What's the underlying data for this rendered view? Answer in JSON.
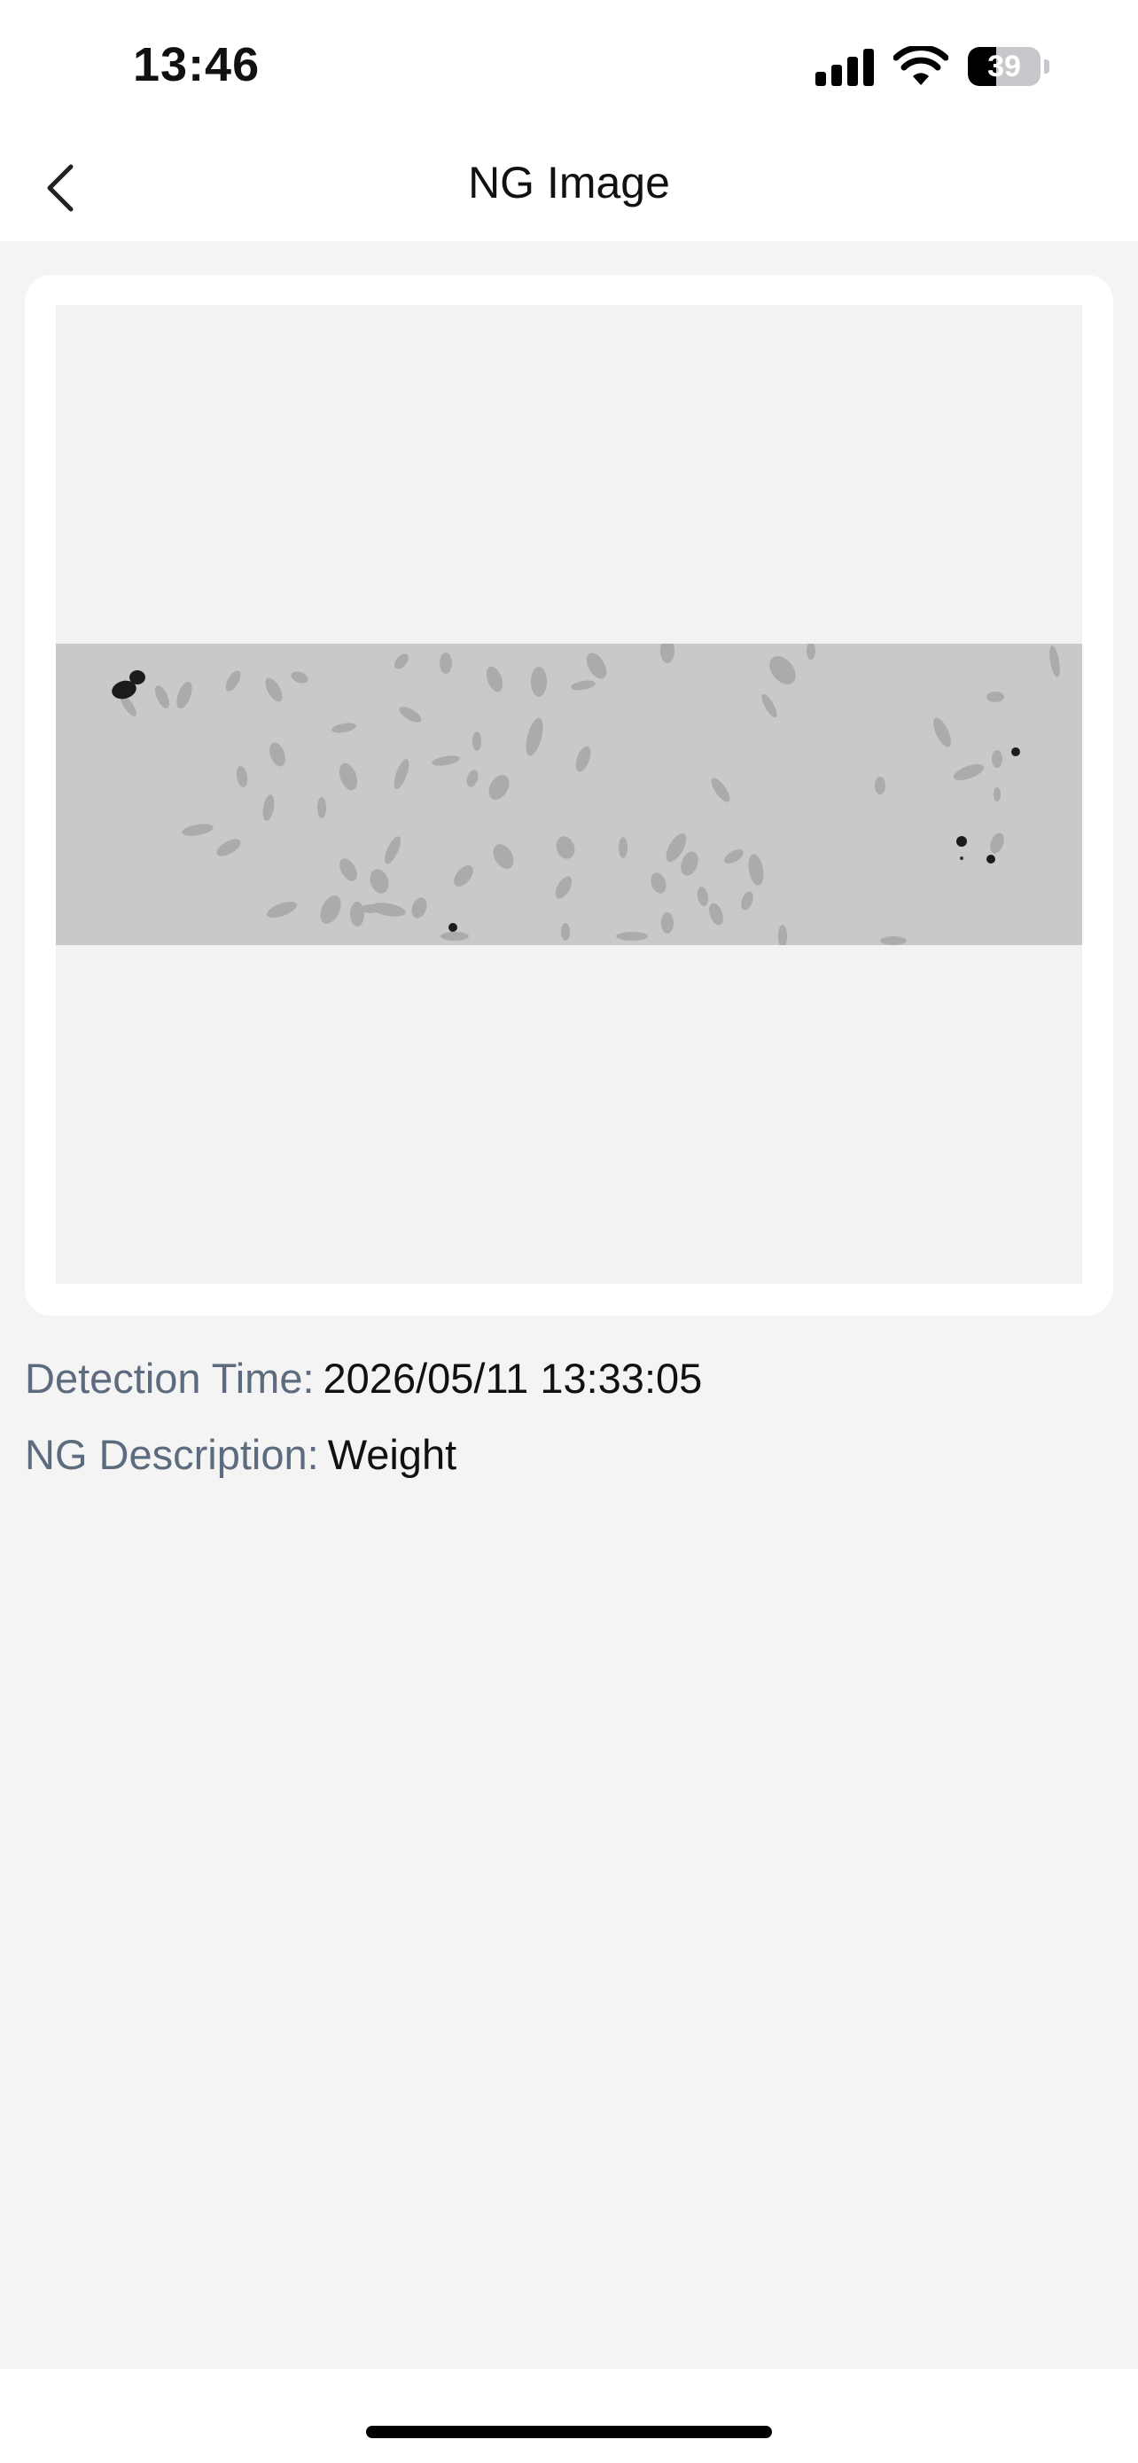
{
  "status_bar": {
    "time": "13:46",
    "battery_level": "39",
    "battery_fraction": 0.39
  },
  "nav": {
    "title": "NG Image",
    "back_icon": "chevron-left-icon"
  },
  "details": {
    "detection_time_label": "Detection Time:",
    "detection_time_value": "2026/05/11 13:33:05",
    "ng_description_label": "NG Description:",
    "ng_description_value": "Weight"
  },
  "colors": {
    "page_background": "#f4f4f5",
    "label": "#5d6b7e",
    "value": "#111111"
  }
}
